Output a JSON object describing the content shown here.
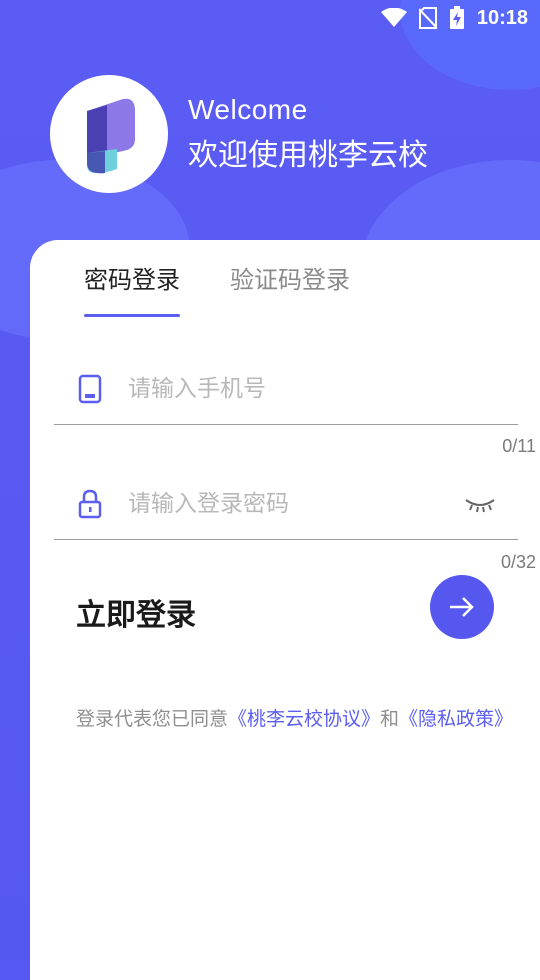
{
  "status_bar": {
    "time": "10:18",
    "icons": [
      "wifi-icon",
      "no-sim-icon",
      "battery-charging-icon"
    ]
  },
  "header": {
    "welcome_en": "Welcome",
    "welcome_zh": "欢迎使用桃李云校"
  },
  "tabs": [
    {
      "label": "密码登录",
      "active": true
    },
    {
      "label": "验证码登录",
      "active": false
    }
  ],
  "phone": {
    "placeholder": "请输入手机号",
    "value": "",
    "counter": "0/11",
    "icon": "phone-icon"
  },
  "password": {
    "placeholder": "请输入登录密码",
    "value": "",
    "counter": "0/32",
    "icon": "lock-icon",
    "toggle_icon": "eye-closed-icon"
  },
  "login": {
    "label": "立即登录",
    "button_icon": "arrow-right-icon"
  },
  "agreement": {
    "prefix": "登录代表您已同意",
    "link1": "《桃李云校协议》",
    "middle": "和",
    "link2": "《隐私政策》"
  },
  "colors": {
    "primary": "#5557EF",
    "text_dark": "#222222",
    "text_gray": "#8F8F8F",
    "placeholder": "#B8B8B8"
  }
}
